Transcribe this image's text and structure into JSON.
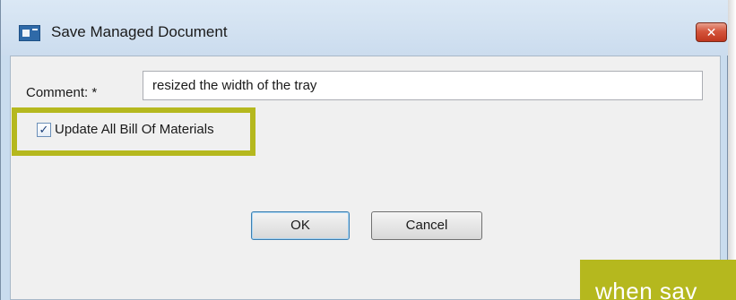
{
  "window": {
    "title": "Save Managed Document",
    "close_glyph": "✕"
  },
  "form": {
    "comment_label": "Comment: *",
    "comment_value": "resized the width of the tray",
    "checkbox_label": "Update All Bill Of Materials",
    "checkbox_checked": true,
    "checkbox_glyph": "✓"
  },
  "buttons": {
    "ok_label": "OK",
    "cancel_label": "Cancel"
  },
  "banner": {
    "text": "when sav"
  },
  "colors": {
    "highlight": "#b5b81e",
    "close_button": "#c0371e",
    "titlebar": "#cbdcee"
  },
  "icons": {
    "window_icon": "application-window-icon",
    "close_icon": "close-icon",
    "checkbox_icon": "checkmark-icon"
  }
}
